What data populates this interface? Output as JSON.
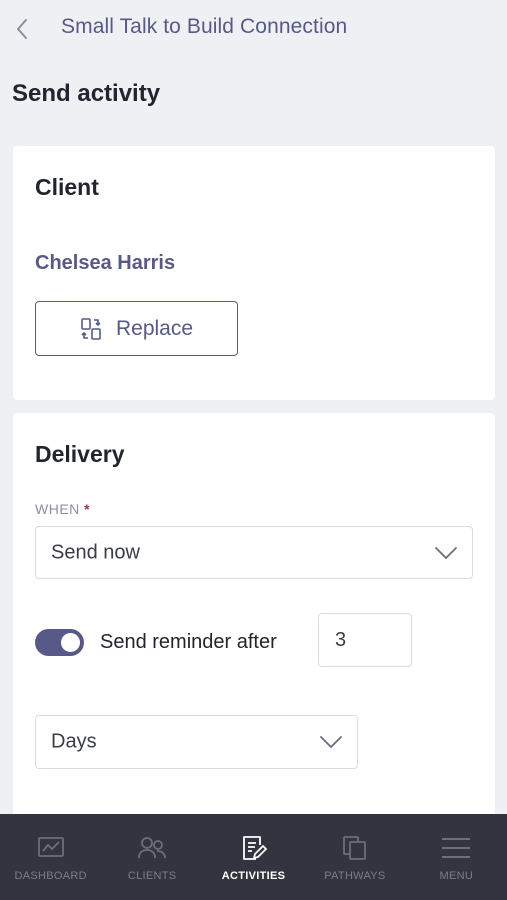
{
  "header": {
    "back_icon": "chevron-left-icon",
    "title": "Small Talk to Build Connection"
  },
  "page_title": "Send activity",
  "client_card": {
    "heading": "Client",
    "client_name": "Chelsea Harris",
    "replace_label": "Replace",
    "replace_icon": "swap-icon"
  },
  "delivery_card": {
    "heading": "Delivery",
    "when_label": "WHEN",
    "required_mark": "*",
    "when_value": "Send now",
    "reminder_enabled": true,
    "reminder_label": "Send reminder after",
    "reminder_count": "3",
    "unit_value": "Days"
  },
  "bottom_nav": {
    "items": [
      {
        "label": "DASHBOARD",
        "icon": "chart-icon",
        "active": false
      },
      {
        "label": "CLIENTS",
        "icon": "people-icon",
        "active": false
      },
      {
        "label": "ACTIVITIES",
        "icon": "edit-document-icon",
        "active": true
      },
      {
        "label": "PATHWAYS",
        "icon": "copy-icon",
        "active": false
      },
      {
        "label": "MENU",
        "icon": "hamburger-icon",
        "active": false
      }
    ]
  },
  "colors": {
    "accent": "#575989",
    "nav_bg": "#33343f",
    "page_bg": "#eef0f3",
    "required": "#a03550"
  }
}
